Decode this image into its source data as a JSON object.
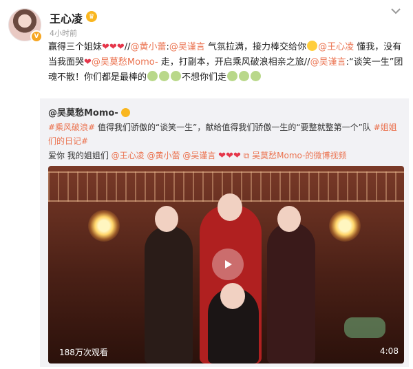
{
  "post": {
    "username": "王心凌",
    "time": "4小时前",
    "line1_a": "赢得三个姐妹",
    "line1_b": "//",
    "mention_1": "@黄小蕾",
    "sep_1": ":",
    "mention_2": "@吴谨言",
    "line1_c": " 气氛拉满，接力棒交给你",
    "mention_3": "@王心凌",
    "line1_d": " 懂我，没有当我面哭",
    "mention_4": "@吴莫愁Momo-",
    "line1_e": " 走，打副本，开启乘风破浪相亲之旅",
    "line1_f": "//",
    "mention_5": "@吴谨言",
    "line1_g": ":“谈笑一生”团魂不散！你们都是最棒的",
    "line1_h": "不想你们走"
  },
  "repost": {
    "username": "@吴莫愁Momo-",
    "tag_1": "#乘风破浪#",
    "text_a": " 值得我们骄傲的“谈笑一生”，献给值得我们骄傲一生的“要整就整第一个”队 ",
    "tag_2": "#姐姐们的日记#",
    "text_b": "爱你 我的姐姐们 ",
    "at_1": "@王心凌",
    "at_2": "@黄小蕾",
    "at_3": "@吴谨言",
    "video_link": "吴莫愁Momo-的微博视频",
    "video": {
      "views": "188万次观看",
      "duration": "4:08"
    }
  },
  "colors": {
    "link": "#eb7350",
    "heart": "#e5364a"
  },
  "icons": [
    "avatar",
    "verified-badge-icon",
    "crown-icon",
    "chevron-down-icon",
    "heart-icon",
    "laugh-emoji-icon",
    "cry-emoji-icon",
    "video-link-icon",
    "play-icon"
  ]
}
